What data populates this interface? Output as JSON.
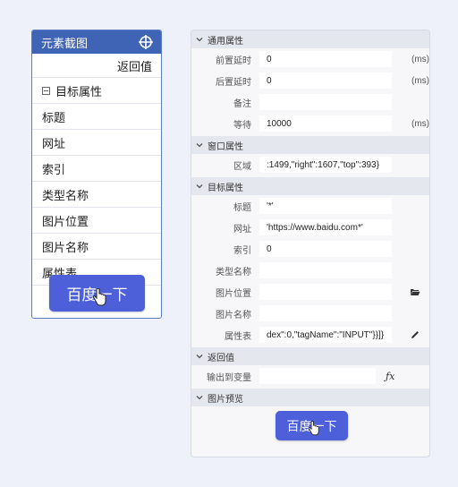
{
  "left_panel": {
    "title": "元素截图",
    "return_label": "返回值",
    "target_group": "目标属性",
    "items": [
      "标题",
      "网址",
      "索引",
      "类型名称",
      "图片位置",
      "图片名称",
      "属性表"
    ],
    "button_text": "百度一下"
  },
  "right_panel": {
    "sections": {
      "general": "通用属性",
      "window": "窗口属性",
      "target": "目标属性",
      "return": "返回值",
      "preview": "图片预览"
    },
    "general": [
      {
        "label": "前置延时",
        "value": "0",
        "unit": "(ms)"
      },
      {
        "label": "后置延时",
        "value": "0",
        "unit": "(ms)"
      },
      {
        "label": "备注",
        "value": "",
        "unit": ""
      },
      {
        "label": "等待",
        "value": "10000",
        "unit": "(ms)"
      }
    ],
    "window": [
      {
        "label": "区域",
        "value": ":1499,\"right\":1607,\"top\":393}"
      }
    ],
    "target": [
      {
        "label": "标题",
        "value": "'*'"
      },
      {
        "label": "网址",
        "value": "'https://www.baidu.com*'"
      },
      {
        "label": "索引",
        "value": "0"
      },
      {
        "label": "类型名称",
        "value": ""
      },
      {
        "label": "图片位置",
        "value": ""
      },
      {
        "label": "图片名称",
        "value": ""
      },
      {
        "label": "属性表",
        "value": "dex\":0,\"tagName\":\"INPUT\"}}]}"
      }
    ],
    "return": [
      {
        "label": "输出到变量",
        "value": ""
      }
    ],
    "preview_button_text": "百度一下"
  },
  "icons": {
    "header": "crosshair-icon",
    "folder": "folder-open-icon",
    "edit": "pencil-icon",
    "formula": "fx-icon",
    "collapse": "chevron-down-icon",
    "cursor": "hand-cursor-icon"
  },
  "colors": {
    "header_bg": "#3f63b5",
    "button_bg": "#4d60d9",
    "section_bg": "#e4e7ee"
  }
}
